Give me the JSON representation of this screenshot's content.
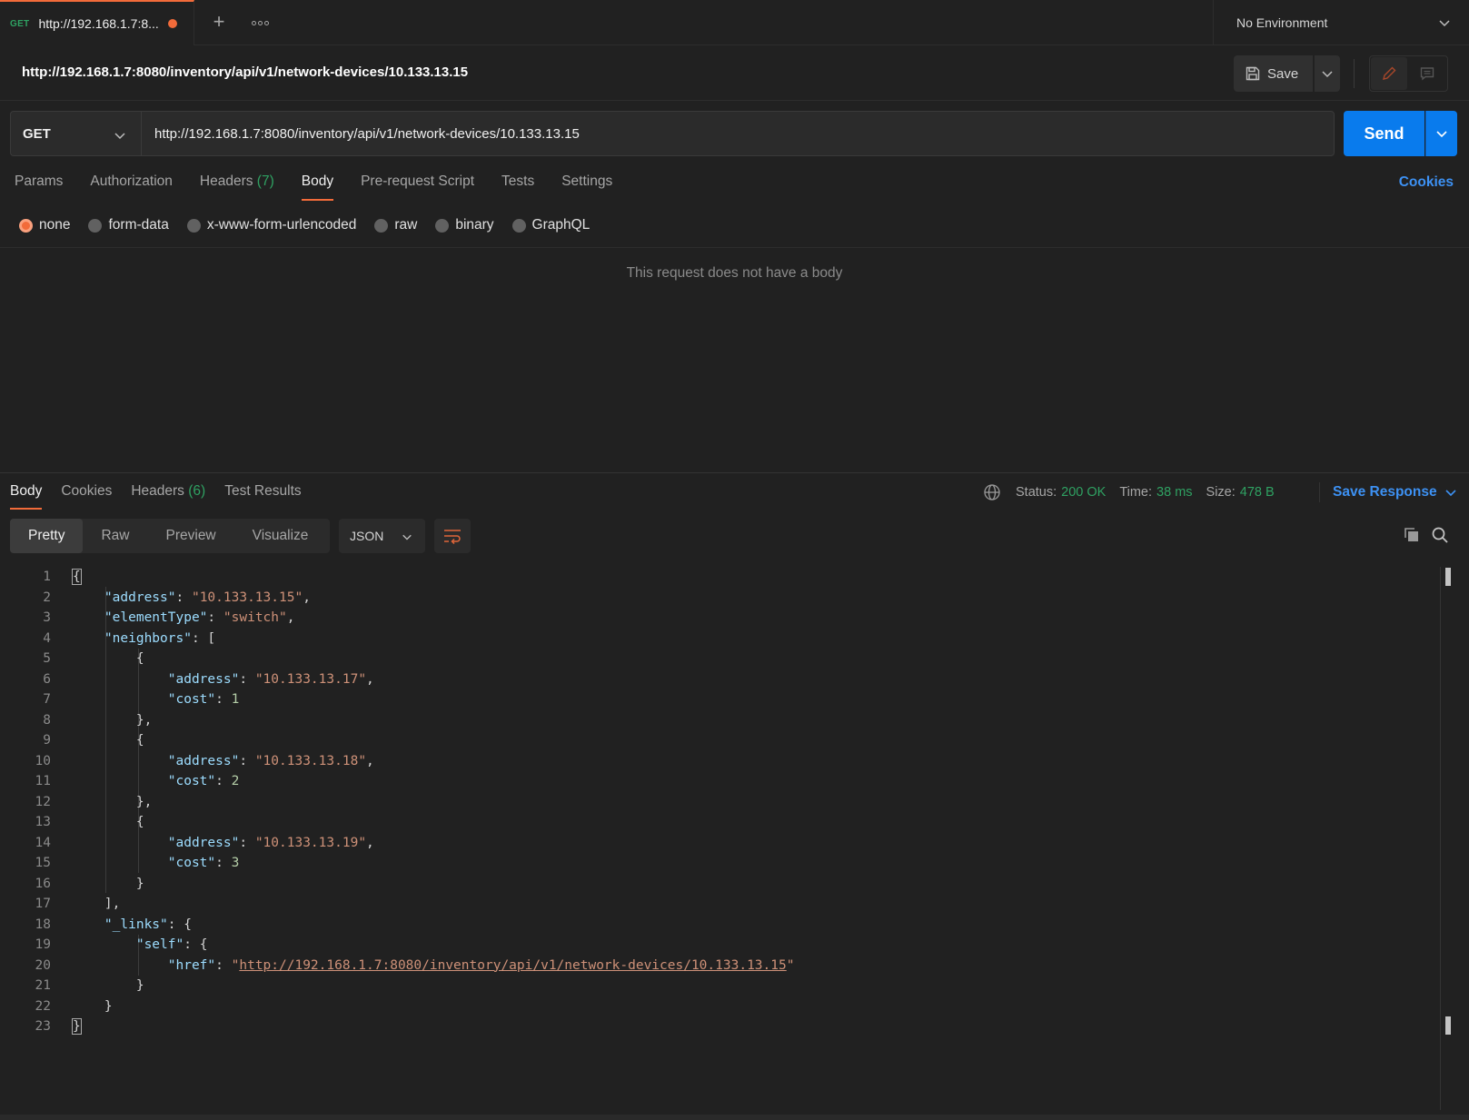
{
  "tab": {
    "method": "GET",
    "title": "http://192.168.1.7:8...",
    "unsaved_indicator": "unsaved-dot"
  },
  "environment": {
    "selected": "No Environment"
  },
  "request": {
    "title": "http://192.168.1.7:8080/inventory/api/v1/network-devices/10.133.13.15",
    "save_label": "Save",
    "method": "GET",
    "url": "http://192.168.1.7:8080/inventory/api/v1/network-devices/10.133.13.15",
    "send_label": "Send"
  },
  "request_tabs": [
    {
      "label": "Params"
    },
    {
      "label": "Authorization"
    },
    {
      "label": "Headers",
      "count": "(7)"
    },
    {
      "label": "Body",
      "active": true
    },
    {
      "label": "Pre-request Script"
    },
    {
      "label": "Tests"
    },
    {
      "label": "Settings"
    }
  ],
  "cookies_link": "Cookies",
  "body_types": [
    {
      "label": "none",
      "selected": true
    },
    {
      "label": "form-data"
    },
    {
      "label": "x-www-form-urlencoded"
    },
    {
      "label": "raw"
    },
    {
      "label": "binary"
    },
    {
      "label": "GraphQL"
    }
  ],
  "no_body_message": "This request does not have a body",
  "response": {
    "tabs": [
      {
        "label": "Body",
        "active": true
      },
      {
        "label": "Cookies"
      },
      {
        "label": "Headers",
        "count": "(6)"
      },
      {
        "label": "Test Results"
      }
    ],
    "status_label": "Status:",
    "status_value": "200 OK",
    "time_label": "Time:",
    "time_value": "38 ms",
    "size_label": "Size:",
    "size_value": "478 B",
    "save_response": "Save Response",
    "views": [
      "Pretty",
      "Raw",
      "Preview",
      "Visualize"
    ],
    "format": "JSON"
  },
  "json_body": {
    "address": "10.133.13.15",
    "elementType": "switch",
    "neighbors": [
      {
        "address": "10.133.13.17",
        "cost": "1"
      },
      {
        "address": "10.133.13.18",
        "cost": "2"
      },
      {
        "address": "10.133.13.19",
        "cost": "3"
      }
    ],
    "self_href": "http://192.168.1.7:8080/inventory/api/v1/network-devices/10.133.13.15"
  },
  "line_numbers": [
    "1",
    "2",
    "3",
    "4",
    "5",
    "6",
    "7",
    "8",
    "9",
    "10",
    "11",
    "12",
    "13",
    "14",
    "15",
    "16",
    "17",
    "18",
    "19",
    "20",
    "21",
    "22",
    "23"
  ],
  "colors": {
    "accent": "#f26b3a",
    "send": "#097bed",
    "link": "#3d91f3",
    "status_ok": "#2fa162",
    "json_key": "#9cdcfe",
    "json_string": "#ce9178",
    "json_number": "#b5cea8"
  }
}
